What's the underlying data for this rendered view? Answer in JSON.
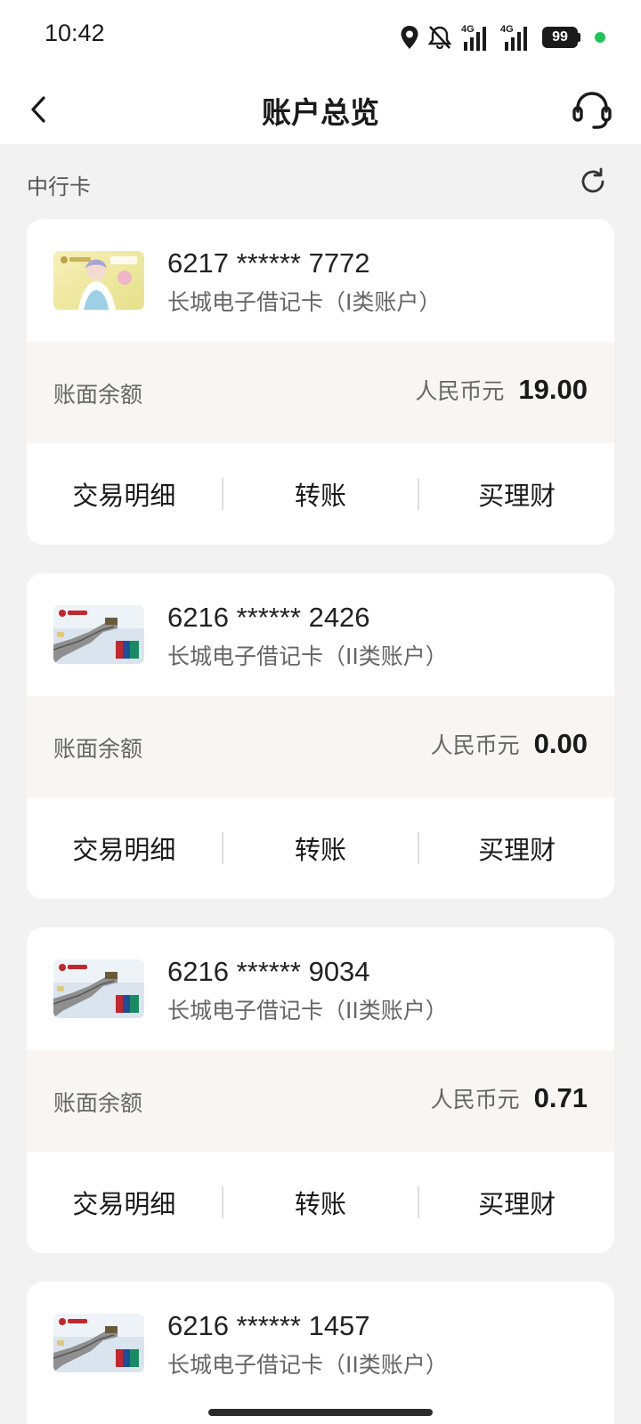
{
  "status": {
    "time": "10:42",
    "signal1_label": "4G",
    "signal2_label": "4G",
    "battery": "99"
  },
  "header": {
    "title": "账户总览"
  },
  "section": {
    "title": "中行卡"
  },
  "cards": [
    {
      "number": "6217 ****** 7772",
      "type": "长城电子借记卡（I类账户）",
      "balance_label": "账面余额",
      "currency": "人民币元",
      "balance": "19.00",
      "actions": [
        "交易明细",
        "转账",
        "买理财"
      ],
      "card_style": "anime-yellow"
    },
    {
      "number": "6216 ****** 2426",
      "type": "长城电子借记卡（II类账户）",
      "balance_label": "账面余额",
      "currency": "人民币元",
      "balance": "0.00",
      "actions": [
        "交易明细",
        "转账",
        "买理财"
      ],
      "card_style": "great-wall"
    },
    {
      "number": "6216 ****** 9034",
      "type": "长城电子借记卡（II类账户）",
      "balance_label": "账面余额",
      "currency": "人民币元",
      "balance": "0.71",
      "actions": [
        "交易明细",
        "转账",
        "买理财"
      ],
      "card_style": "great-wall"
    },
    {
      "number": "6216 ****** 1457",
      "type": "长城电子借记卡（II类账户）",
      "card_style": "great-wall"
    }
  ],
  "icons": {
    "back": "chevron-left-icon",
    "support": "headset-icon",
    "refresh": "refresh-icon"
  },
  "colors": {
    "page_bg": "#f2f2f2",
    "balance_bg": "#f8f5f2",
    "status_dot": "#20c45a"
  }
}
